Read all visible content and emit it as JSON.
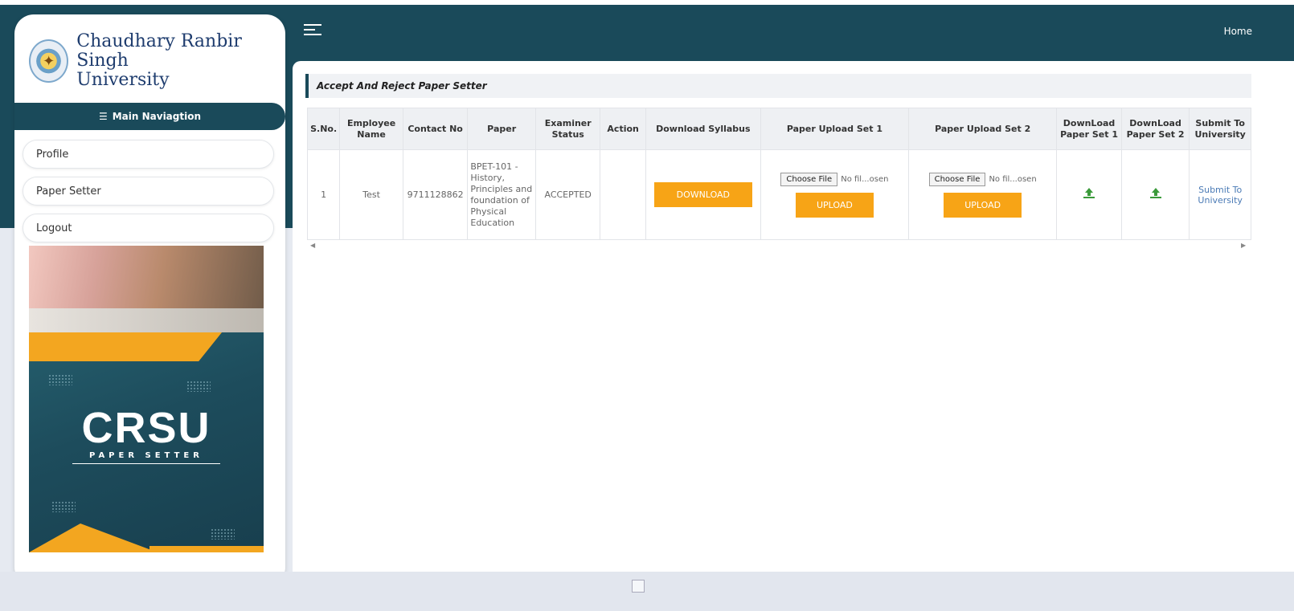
{
  "logo": {
    "line1": "Chaudhary Ranbir Singh",
    "line2": "University"
  },
  "nav": {
    "header": "Main Naviagtion",
    "items": [
      {
        "label": "Profile"
      },
      {
        "label": "Paper Setter"
      },
      {
        "label": "Logout"
      }
    ]
  },
  "banner": {
    "title": "CRSU",
    "subtitle": "PAPER SETTER"
  },
  "header": {
    "home_label": "Home"
  },
  "section": {
    "title": "Accept And Reject Paper Setter"
  },
  "table": {
    "columns": [
      "S.No.",
      "Employee Name",
      "Contact No",
      "Paper",
      "Examiner Status",
      "Action",
      "Download Syllabus",
      "Paper Upload Set 1",
      "Paper Upload Set 2",
      "DownLoad Paper Set 1",
      "DownLoad Paper Set 2",
      "Submit To University"
    ],
    "rows": [
      {
        "sno": "1",
        "employee_name": "Test",
        "contact_no": "9711128862",
        "paper": "BPET-101 - History, Principles and foundation of Physical Education",
        "examiner_status": "ACCEPTED",
        "action": "",
        "download_label": "DOWNLOAD",
        "upload1": {
          "choose_label": "Choose File",
          "file_status": "No fil...osen",
          "upload_label": "UPLOAD"
        },
        "upload2": {
          "choose_label": "Choose File",
          "file_status": "No fil...osen",
          "upload_label": "UPLOAD"
        },
        "submit_label": "Submit To University"
      }
    ]
  },
  "colors": {
    "header_bg": "#1a4a5a",
    "accent_orange": "#f7a416",
    "download_icon": "#3a9a3a"
  },
  "icons": {
    "menu": "hamburger-icon",
    "nav": "list-icon",
    "download": "download-icon"
  }
}
